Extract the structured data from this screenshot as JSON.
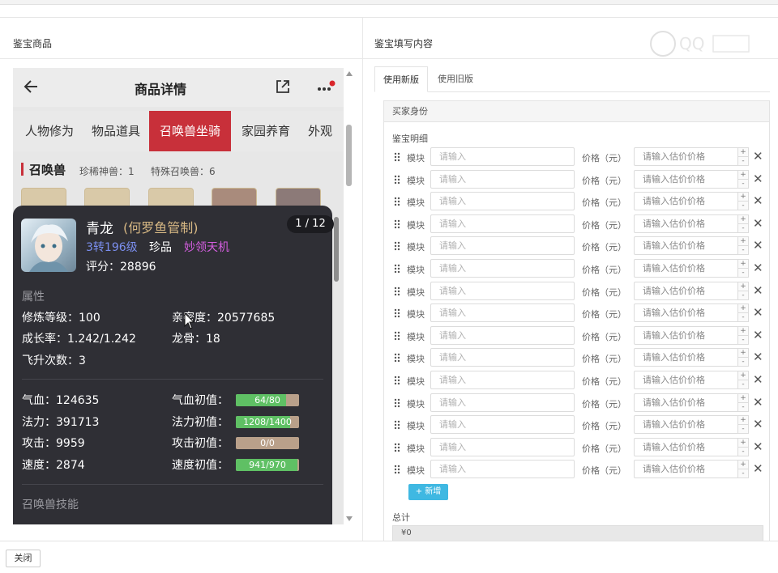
{
  "left": {
    "section_title": "鉴宝商品",
    "phone": {
      "title": "商品详情",
      "tabs": [
        "人物修为",
        "物品道具",
        "召唤兽坐骑",
        "家园养育",
        "外观"
      ],
      "active_tab": 2,
      "subheader": {
        "title": "召唤兽",
        "stat1": "珍稀神兽：1",
        "stat2": "特殊召唤兽：6"
      }
    },
    "detail": {
      "name": "青龙",
      "owner": "(何罗鱼管制)",
      "level": "3转196级",
      "quality": "珍品",
      "tag": "妙领天机",
      "score": "评分：28896",
      "page": "1 / 12",
      "attr_title": "属性",
      "attrs": {
        "cultivation": "修炼等级：100",
        "intimacy": "亲密度：20577685",
        "growth": "成长率：1.242/1.242",
        "dragon_bone": "龙骨：18",
        "ascend": "飞升次数：3"
      },
      "stats": {
        "hp": "气血：124635",
        "mp": "法力：391713",
        "atk": "攻击：9959",
        "spd": "速度：2874"
      },
      "initials": {
        "hp_label": "气血初值：",
        "mp_label": "法力初值：",
        "atk_label": "攻击初值：",
        "spd_label": "速度初值：",
        "hp_bar": {
          "text": "64/80",
          "fraction": 0.8
        },
        "mp_bar": {
          "text": "1208/1400",
          "fraction": 0.863
        },
        "atk_bar": {
          "text": "0/0",
          "fraction": 0
        },
        "spd_bar": {
          "text": "941/970",
          "fraction": 0.97
        }
      },
      "skill_title": "召唤兽技能"
    }
  },
  "right": {
    "section_title": "鉴宝填写内容",
    "tabs": [
      "使用新版",
      "使用旧版"
    ],
    "active_tab": 0,
    "buyer_title": "买家身份",
    "detail_label": "鉴宝明细",
    "row_module_label": "模块",
    "row_input_placeholder": "请输入",
    "row_price_label": "价格（元）",
    "row_price_placeholder": "请输入估价价格",
    "stepper_plus": "+",
    "stepper_minus": "-",
    "delete_glyph": "✕",
    "add_button": "+ 新增",
    "total_label": "总计",
    "total_value": "¥0"
  },
  "footer": {
    "close_button": "关闭"
  },
  "colors": {
    "accent_red": "#c8303a",
    "add_button_blue": "#3fb8e2",
    "progress_green": "#5fc064"
  },
  "icons": [
    "back-arrow-icon",
    "share-icon",
    "more-icon",
    "drag-grip-icon",
    "close-icon",
    "watermark-logo"
  ]
}
